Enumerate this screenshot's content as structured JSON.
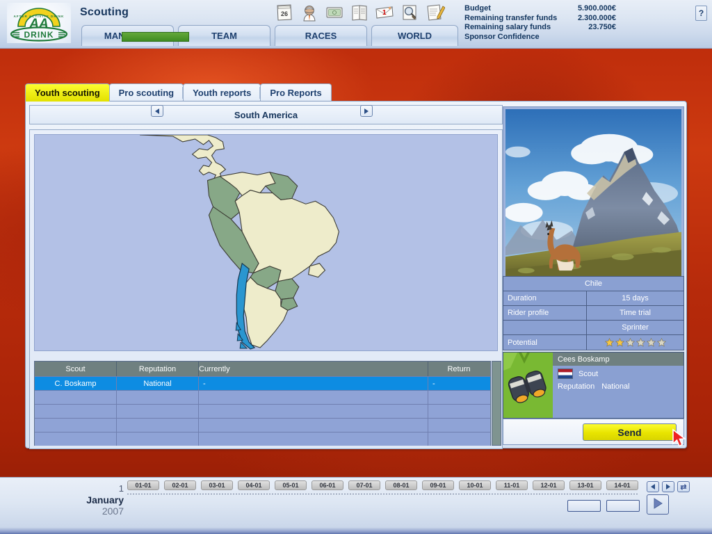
{
  "header": {
    "logo_alt": "AA Drink",
    "title": "Scouting",
    "nav_tabs": [
      {
        "id": "manager",
        "label": "MANAGER"
      },
      {
        "id": "team",
        "label": "TEAM"
      },
      {
        "id": "races",
        "label": "RACES"
      },
      {
        "id": "world",
        "label": "WORLD"
      }
    ],
    "icons": [
      {
        "name": "calendar-icon",
        "badge": "26"
      },
      {
        "name": "cyclist-icon",
        "badge": ""
      },
      {
        "name": "money-icon",
        "badge": ""
      },
      {
        "name": "newspaper-icon",
        "badge": ""
      },
      {
        "name": "mail-icon",
        "badge": "1"
      },
      {
        "name": "search-icon",
        "badge": ""
      },
      {
        "name": "notepad-icon",
        "badge": ""
      }
    ],
    "finance": [
      {
        "label": "Budget",
        "value": "5.900.000€"
      },
      {
        "label": "Remaining transfer funds",
        "value": "2.300.000€"
      },
      {
        "label": "Remaining salary funds",
        "value": "23.750€"
      },
      {
        "label": "Sponsor Confidence",
        "value": ""
      }
    ],
    "sponsor_confidence_color": "#4e9a2a",
    "help_label": "?"
  },
  "subtabs": [
    {
      "id": "youth-scouting",
      "label": "Youth scouting",
      "active": true
    },
    {
      "id": "pro-scouting",
      "label": "Pro scouting",
      "active": false
    },
    {
      "id": "youth-reports",
      "label": "Youth reports",
      "active": false
    },
    {
      "id": "pro-reports",
      "label": "Pro Reports",
      "active": false
    }
  ],
  "map": {
    "region_title": "South America",
    "prev_icon": "left-arrow-icon",
    "next_icon": "right-arrow-icon",
    "selected_country": "Chile",
    "selected_color": "#2a96d0",
    "highlight_color": "#87a887",
    "land_color": "#eeeccb",
    "ocean_color": "#b3c1e6"
  },
  "scout_table": {
    "columns": [
      "Scout",
      "Reputation",
      "Currently",
      "Return"
    ],
    "rows": [
      {
        "scout": "C. Boskamp",
        "reputation": "National",
        "currently": "-",
        "return": "-",
        "selected": true
      },
      {
        "scout": "",
        "reputation": "",
        "currently": "",
        "return": "",
        "selected": false
      },
      {
        "scout": "",
        "reputation": "",
        "currently": "",
        "return": "",
        "selected": false
      },
      {
        "scout": "",
        "reputation": "",
        "currently": "",
        "return": "",
        "selected": false
      },
      {
        "scout": "",
        "reputation": "",
        "currently": "",
        "return": "",
        "selected": false
      }
    ],
    "header_color": "#6f8080",
    "selected_row_color": "#0d8ce2",
    "row_color": "#8fa3d6"
  },
  "country_panel": {
    "photo_caption": "Chile",
    "photo_alt": "Guanaco in front of Torres del Paine mountains",
    "rows": [
      {
        "key": "Duration",
        "value": "15 days"
      },
      {
        "key": "Rider profile",
        "value": "Time trial"
      },
      {
        "key": "",
        "value": "Sprinter"
      }
    ],
    "potential_label": "Potential",
    "potential_filled": 2,
    "potential_total": 6,
    "star_filled_color": "#f5c542",
    "star_empty_color": "#d9d6c4"
  },
  "scout_card": {
    "name": "Cees Boskamp",
    "flag": "netherlands-flag",
    "role": "Scout",
    "reputation_label": "Reputation",
    "reputation_value": "National",
    "send_label": "Send"
  },
  "bottom": {
    "date_day": "1",
    "date_month": "January",
    "date_year": "2007",
    "days": [
      "01-01",
      "02-01",
      "03-01",
      "04-01",
      "05-01",
      "06-01",
      "07-01",
      "08-01",
      "09-01",
      "10-01",
      "11-01",
      "12-01",
      "13-01",
      "14-01"
    ],
    "mini_prev_icon": "left-arrow-icon",
    "mini_next_icon": "right-arrow-icon",
    "mini_cycle_icon": "swap-icon",
    "play_icon": "play-icon"
  }
}
